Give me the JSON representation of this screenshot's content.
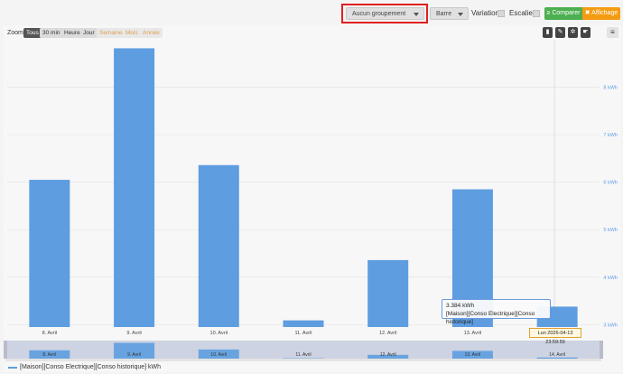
{
  "toolbar": {
    "grouping_select": "Aucun groupement",
    "type_select": "Barre",
    "variation_label": "Variation",
    "staircase_label": "Escalier",
    "compare_label": "≥ Comparer",
    "display_label": "✖ Affichage"
  },
  "zoom": {
    "label": "Zoom",
    "buttons": [
      {
        "label": "Tous",
        "state": "active"
      },
      {
        "label": "30 min",
        "state": "normal"
      },
      {
        "label": "Heure",
        "state": "normal"
      },
      {
        "label": "Jour",
        "state": "normal"
      },
      {
        "label": "Semaine",
        "state": "disabled"
      },
      {
        "label": "Mois",
        "state": "disabled"
      },
      {
        "label": "Année",
        "state": "disabled"
      }
    ]
  },
  "tools": [
    "trash-icon",
    "pencil-icon",
    "gear-icon",
    "pointer-icon"
  ],
  "colors": {
    "bar": "#5d9de0",
    "accent_red": "#e02020",
    "compare": "#4caf50",
    "display": "#f39c12"
  },
  "tooltip": {
    "value": "3.384 kWh",
    "series": "[Maison][Conso Electrique][Conso historique]"
  },
  "navigator_date": "Lun 2026-04-13 23:59:59",
  "chart_data": {
    "type": "bar",
    "categories": [
      "8. Avril",
      "9. Avril",
      "10. Avril",
      "11. Avril",
      "12. Avril",
      "13. Avril",
      "14. Avril"
    ],
    "series": [
      {
        "name": "[Maison][Conso Electrique][Conso historique] kWh",
        "values": [
          6.05,
          8.82,
          6.36,
          3.09,
          4.36,
          5.85,
          3.38
        ]
      }
    ],
    "y_tick_labels": [
      "3 kWh",
      "4 kWh",
      "5 kWh",
      "6 kWh",
      "7 kWh",
      "8 kWh"
    ],
    "y_ticks": [
      3,
      4,
      5,
      6,
      7,
      8
    ],
    "ylim": [
      2.95,
      9.0
    ],
    "y_axis_side": "right",
    "grid": true,
    "legend": "bottom-left"
  }
}
